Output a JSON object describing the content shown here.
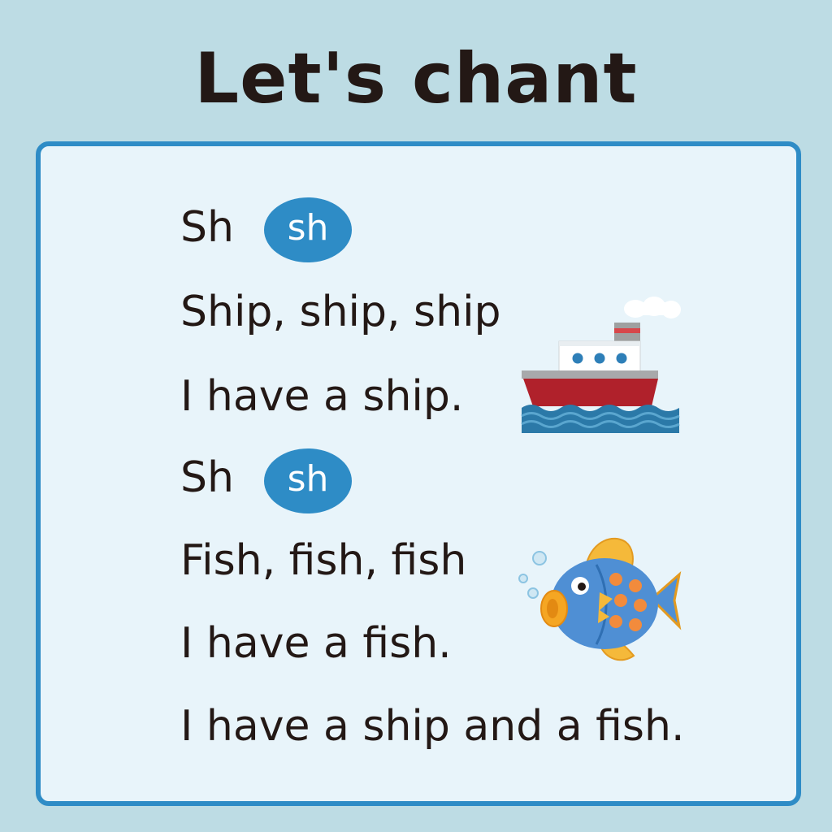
{
  "title": "Let's chant",
  "lines": [
    "Sh",
    "Ship, ship, ship",
    "I have a ship.",
    "Sh",
    "Fish, fish, fish",
    "I have a fish.",
    "I have a ship and a fish."
  ],
  "badges": [
    "sh",
    "sh"
  ],
  "images": {
    "ship": "ship-illustration",
    "fish": "fish-illustration"
  },
  "colors": {
    "background": "#bddce4",
    "panel": "#e8f4fa",
    "panel_border": "#2e8cc6",
    "badge": "#2e8cc6",
    "text": "#231815"
  }
}
